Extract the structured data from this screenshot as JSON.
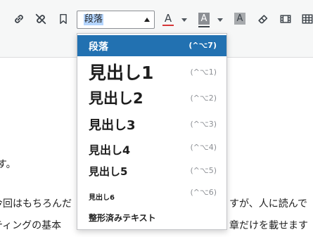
{
  "toolbar": {
    "format_select": {
      "value": "段落"
    },
    "icons": [
      "link-icon",
      "unlink-icon",
      "bookmark-icon",
      "text-color-icon",
      "background-color-icon",
      "highlight-icon",
      "eraser-icon",
      "media-icon",
      "table-icon"
    ],
    "text_color_letter": "A",
    "bg_color_letter": "A",
    "highlight_letter": "A",
    "colors": {
      "text_color": "#d63638",
      "bg_underline": "#8c8f94"
    }
  },
  "format_menu": {
    "items": [
      {
        "label": "段落",
        "shortcut": "(^⌥7)",
        "active": true
      },
      {
        "label": "見出し1",
        "shortcut": "(^⌥1)"
      },
      {
        "label": "見出し2",
        "shortcut": "(^⌥2)"
      },
      {
        "label": "見出し3",
        "shortcut": "(^⌥3)"
      },
      {
        "label": "見出し4",
        "shortcut": "(^⌥4)"
      },
      {
        "label": "見出し5",
        "shortcut": "(^⌥5)"
      },
      {
        "label": "見出し6",
        "shortcut": "(^⌥6)"
      },
      {
        "label": "整形済みテキスト",
        "shortcut": ""
      }
    ],
    "accent": "#2271b1"
  },
  "editor": {
    "line1": "す。",
    "line2_left": "今回はもちろんだ",
    "line2_right": "すが、人に読んで",
    "line3_left": "ティングの基本",
    "line3_right": "章だけを載せます"
  }
}
